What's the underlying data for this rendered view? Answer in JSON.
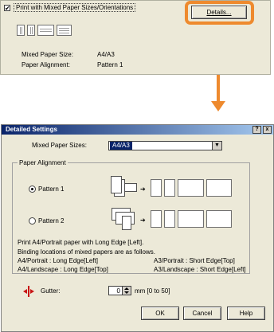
{
  "top_panel": {
    "checkbox_label": "Print with Mixed Paper Sizes/Orientations",
    "checkbox_mark": "✔",
    "details_button": "Details...",
    "mixed_paper_size_label": "Mixed Paper Size:",
    "mixed_paper_size_value": "A4/A3",
    "paper_alignment_label": "Paper Alignment:",
    "paper_alignment_value": "Pattern 1"
  },
  "dialog": {
    "title": "Detailed Settings",
    "help_btn": "?",
    "close_btn": "x",
    "mixed_paper_sizes_label": "Mixed Paper Sizes:",
    "mixed_paper_sizes_value": "A4/A3",
    "dropdown_arrow": "▼",
    "paper_alignment_group": "Paper Alignment",
    "pattern1_label": "Pattern 1",
    "pattern2_label": "Pattern 2",
    "pattern1_selected": true,
    "description_line1": "Print A4/Portrait paper with Long Edge [Left].",
    "description_line2": "Binding locations of mixed papers are as follows.",
    "binding_a4_portrait": "A4/Portrait : Long Edge[Left]",
    "binding_a3_portrait": "A3/Portrait : Short Edge[Top]",
    "binding_a4_landscape": "A4/Landscape : Long Edge[Top]",
    "binding_a3_landscape": "A3/Landscape : Short Edge[Left]",
    "gutter_label": "Gutter:",
    "gutter_value": "0",
    "gutter_range": "mm [0 to 50]",
    "ok_button": "OK",
    "cancel_button": "Cancel",
    "help_button": "Help"
  },
  "colors": {
    "highlight": "#ee8a2e",
    "titlebar_start": "#0a246a",
    "titlebar_end": "#a6caf0",
    "dialog_bg": "#ece9d8"
  }
}
